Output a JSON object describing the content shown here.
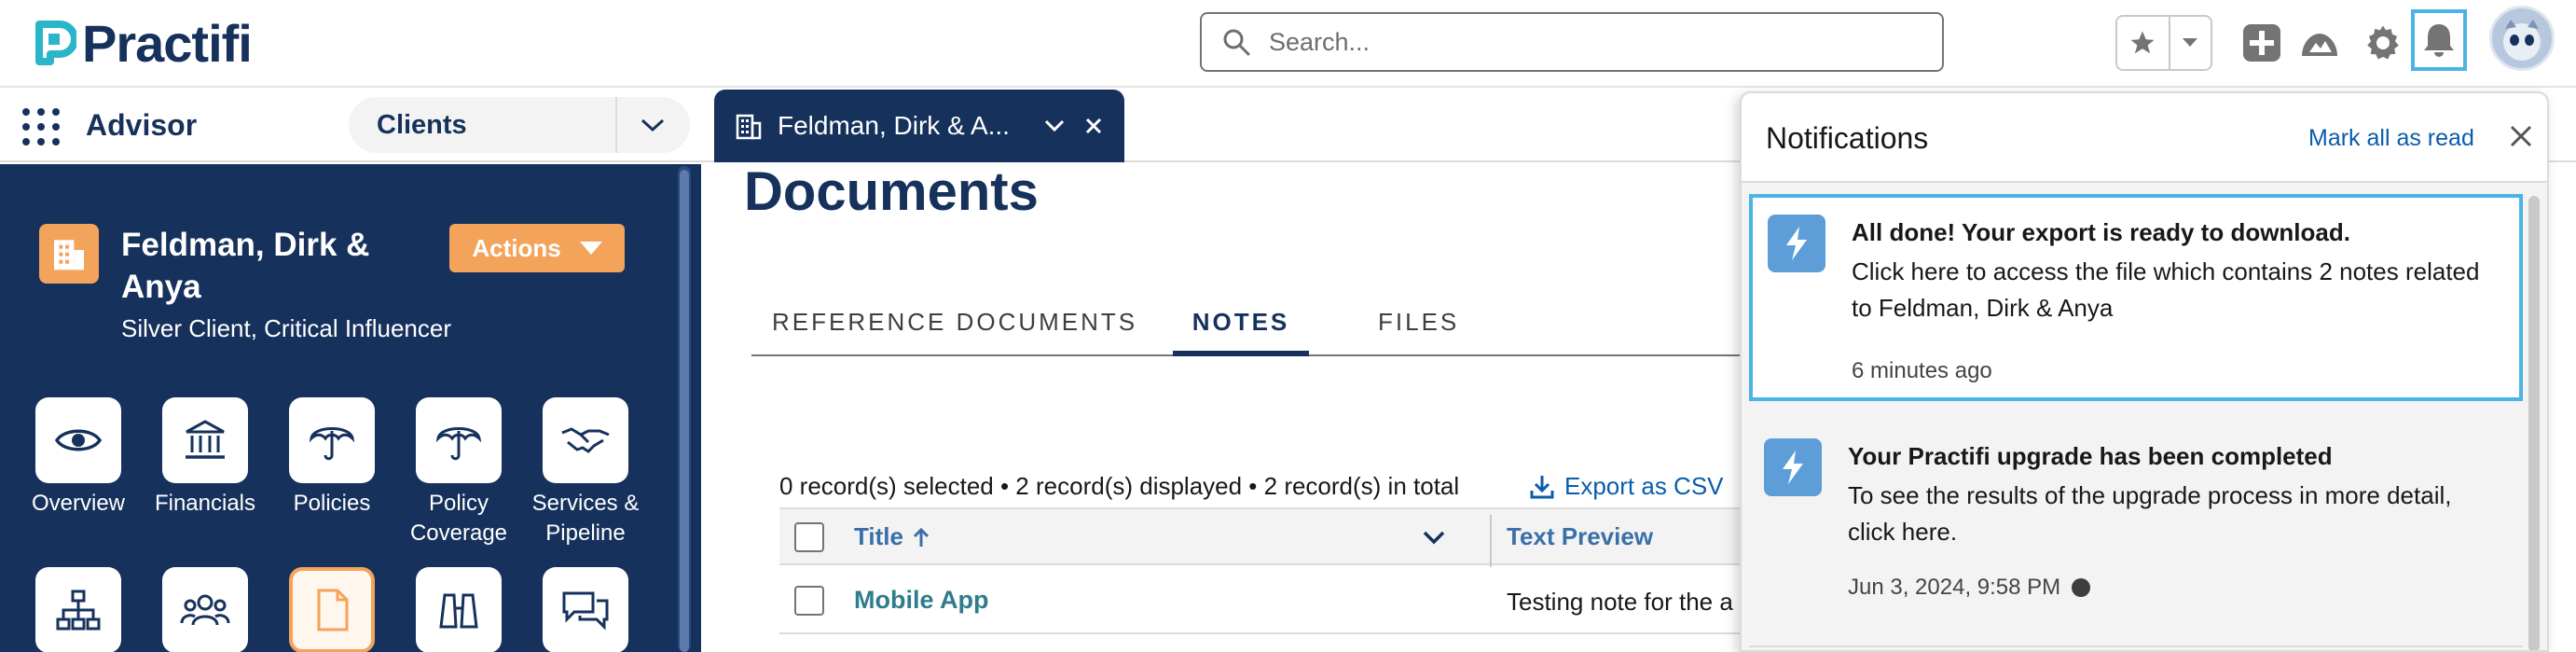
{
  "header": {
    "logo_text": "Practifi",
    "search_placeholder": "Search...",
    "icons": [
      "star-icon",
      "chevron-down-icon",
      "plus-icon",
      "trailhead-icon",
      "gear-icon",
      "bell-icon",
      "avatar"
    ]
  },
  "nav": {
    "app_name": "Advisor",
    "object_selector": "Clients",
    "active_tab": {
      "label": "Feldman, Dirk & A...",
      "icon": "building-icon"
    }
  },
  "client": {
    "name": "Feldman, Dirk & Anya",
    "subtitle": "Silver Client, Critical Influencer",
    "actions_label": "Actions",
    "tiles": [
      {
        "label": "Overview",
        "icon": "eye-icon"
      },
      {
        "label": "Financials",
        "icon": "bank-icon"
      },
      {
        "label": "Policies",
        "icon": "umbrella-icon"
      },
      {
        "label": "Policy Coverage",
        "icon": "umbrella-icon"
      },
      {
        "label": "Services & Pipeline",
        "icon": "handshake-icon"
      },
      {
        "label": "",
        "icon": "hierarchy-icon"
      },
      {
        "label": "",
        "icon": "people-icon"
      },
      {
        "label": "",
        "icon": "document-icon",
        "selected": true
      },
      {
        "label": "",
        "icon": "binoculars-icon"
      },
      {
        "label": "",
        "icon": "chat-icon"
      }
    ]
  },
  "main": {
    "title": "Documents",
    "subtabs": [
      {
        "label": "REFERENCE DOCUMENTS",
        "active": false
      },
      {
        "label": "NOTES",
        "active": true
      },
      {
        "label": "FILES",
        "active": false
      }
    ],
    "record_info": "0 record(s) selected • 2 record(s) displayed • 2 record(s) in total",
    "export_label": "Export as CSV",
    "table": {
      "columns": [
        "Title",
        "Text Preview"
      ],
      "rows": [
        {
          "title": "Mobile App",
          "preview": "Testing note for the a"
        }
      ]
    }
  },
  "notifications": {
    "title": "Notifications",
    "mark_all_label": "Mark all as read",
    "items": [
      {
        "heading": "All done! Your export is ready to download.",
        "body": "Click here to access the file which contains 2 notes related to Feldman, Dirk & Anya",
        "time": "6 minutes ago",
        "highlighted": true
      },
      {
        "heading": "Your Practifi upgrade has been completed",
        "body": "To see the results of the upgrade process in more detail, click here.",
        "time": "Jun 3, 2024, 9:58 PM",
        "unread": true
      }
    ]
  },
  "colors": {
    "brand_navy": "#16325c",
    "brand_teal": "#2bb5c9",
    "accent_orange": "#f4a35b",
    "highlight_blue": "#4bb4e6",
    "link_blue": "#0b5cab"
  }
}
